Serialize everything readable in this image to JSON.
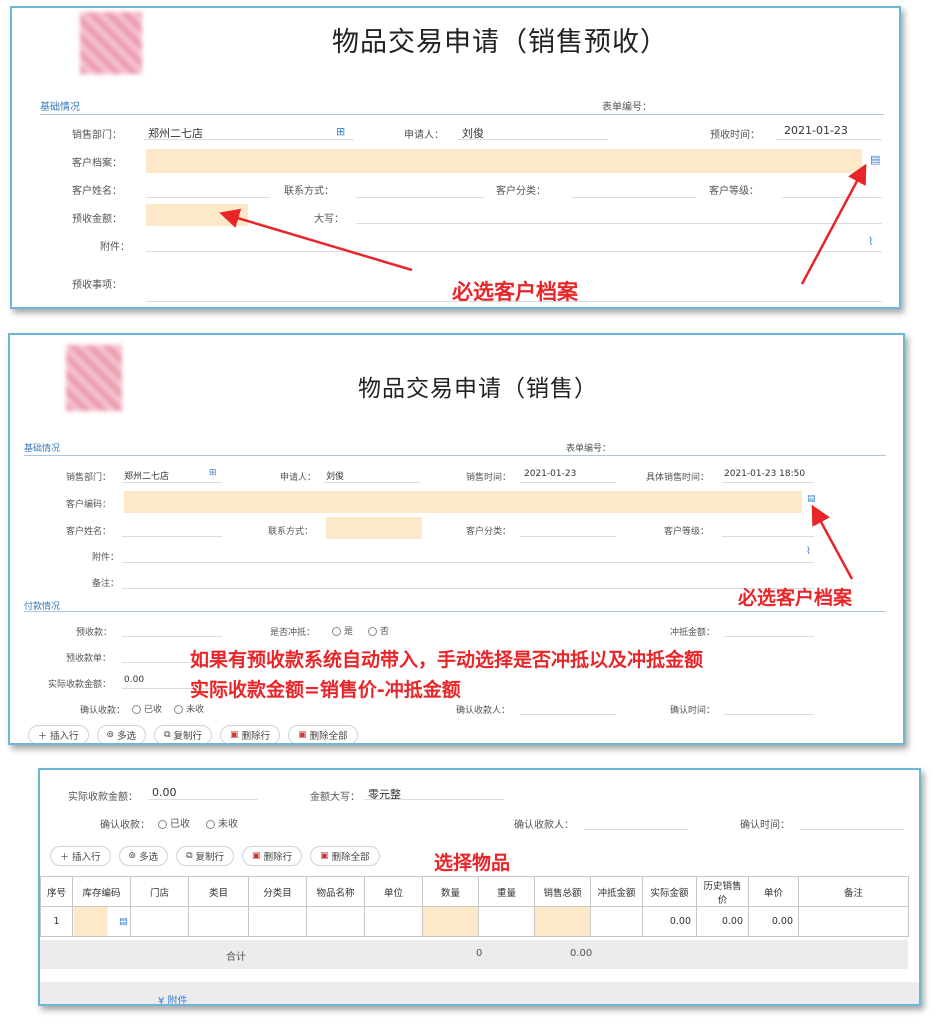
{
  "panel1": {
    "title": "物品交易申请（销售预收）",
    "section_basic": "基础情况",
    "form_no_label": "表单编号：",
    "dept_label": "销售部门：",
    "dept_value": "郑州二七店",
    "applicant_label": "申请人：",
    "applicant_value": "刘俊",
    "prepay_time_label": "预收时间：",
    "prepay_time_value": "2021-01-23",
    "customer_file_label": "客户档案：",
    "customer_name_label": "客户姓名：",
    "contact_label": "联系方式：",
    "customer_group_label": "客户分类：",
    "customer_level_label": "客户等级：",
    "prepay_amount_label": "预收金额：",
    "capital_label": "大写：",
    "attach_label": "附件：",
    "prepay_item_label": "预收事项：",
    "annotation": "必选客户档案"
  },
  "panel2": {
    "title": "物品交易申请（销售）",
    "section_basic": "基础情况",
    "form_no_label": "表单编号：",
    "dept_label": "销售部门：",
    "dept_value": "郑州二七店",
    "applicant_label": "申请人：",
    "applicant_value": "刘俊",
    "sale_time_label": "销售时间：",
    "sale_time_value": "2021-01-23",
    "delivery_time_label": "具体销售时间：",
    "delivery_time_value": "2021-01-23 18:50",
    "customer_code_label": "客户编码：",
    "customer_name_label": "客户姓名：",
    "contact_label": "联系方式：",
    "customer_group_label": "客户分类：",
    "customer_level_label": "客户等级：",
    "attach_label": "附件：",
    "remark_label": "备注：",
    "section_pay": "付款情况",
    "prepay_label": "预收款：",
    "offset_label": "是否冲抵：",
    "yes_label": "是",
    "no_label": "否",
    "offset_amount_label": "冲抵金额：",
    "prepay_no_label": "预收款单：",
    "actual_label": "实际收款金额：",
    "actual_value": "0.00",
    "confirm_label": "确认收款：",
    "received_label": "已收",
    "unreceived_label": "未收",
    "confirmer_label": "确认收款人：",
    "confirm_time_label": "确认时间：",
    "annotation_top": "必选客户档案",
    "annotation_line1": "如果有预收款系统自动带入，手动选择是否冲抵以及冲抵金额",
    "annotation_line2": "实际收款金额=销售价-冲抵金额",
    "buttons": [
      "插入行",
      "多选",
      "复制行",
      "删除行",
      "删除全部"
    ]
  },
  "panel3": {
    "actual_label": "实际收款金额：",
    "actual_value": "0.00",
    "capital_label": "金额大写：",
    "capital_value": "零元整",
    "confirm_label": "确认收款：",
    "received_label": "已收",
    "unreceived_label": "未收",
    "confirmer_label": "确认收款人：",
    "confirm_time_label": "确认时间：",
    "buttons": [
      "插入行",
      "多选",
      "复制行",
      "删除行",
      "删除全部"
    ],
    "annotation": "选择物品",
    "columns": [
      "序号",
      "库存编码",
      "门店",
      "类目",
      "分类目",
      "物品名称",
      "单位",
      "数量",
      "重量",
      "销售总额",
      "冲抵金额",
      "实际金额",
      "历史销售价",
      "单价",
      "备注"
    ],
    "row": {
      "index": "1",
      "actual": "0.00",
      "history": "0.00",
      "price": "0.00"
    },
    "total_label": "合计",
    "total_qty": "0",
    "total_amount": "0.00",
    "footer": "附件"
  },
  "colors": {
    "border": "#6cb6d6",
    "required": "#fde9c7",
    "annotation": "#e8262a",
    "section": "#3a7ab8"
  },
  "icons": [
    "org-picker-icon",
    "lookup-icon",
    "paperclip-icon",
    "plus-icon",
    "multi-select-icon",
    "copy-icon",
    "delete-icon",
    "delete-all-icon",
    "expand-icon"
  ]
}
